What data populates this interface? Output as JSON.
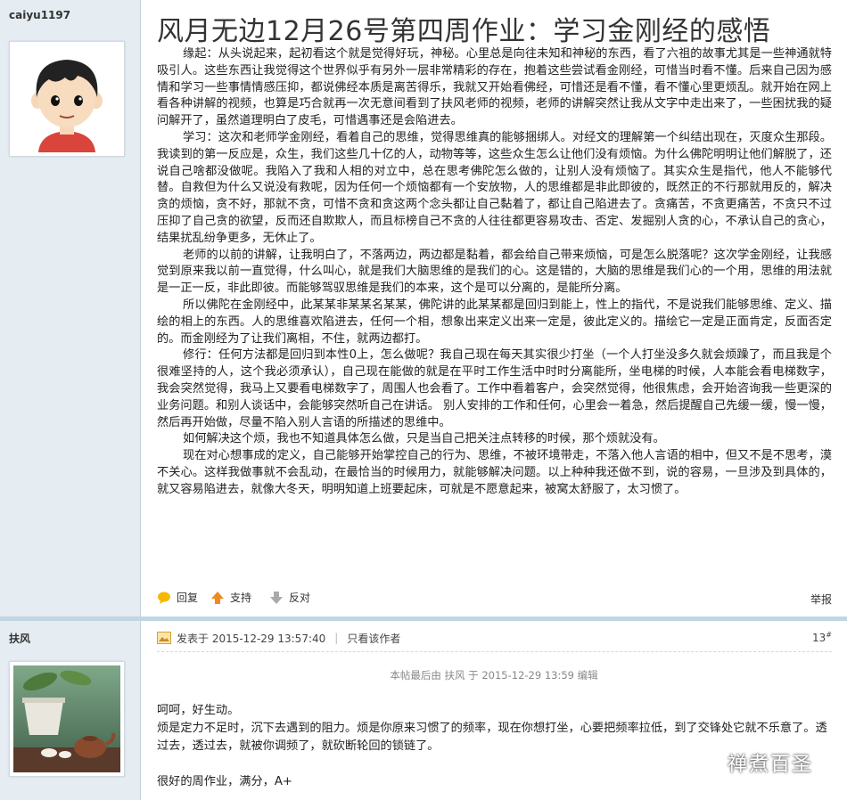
{
  "post1": {
    "username": "caiyu1197",
    "title": "风月无边12月26号第四周作业：学习金刚经的感悟",
    "paragraphs": [
      "缘起：从头说起来，起初看这个就是觉得好玩，神秘。心里总是向往未知和神秘的东西，看了六祖的故事尤其是一些神通就特吸引人。这些东西让我觉得这个世界似乎有另外一层非常精彩的存在，抱着这些尝试看金刚经，可惜当时看不懂。后来自己因为感情和学习一些事情情感压抑，都说佛经本质是离苦得乐，我就又开始看佛经，可惜还是看不懂，看不懂心里更烦乱。就开始在网上看各种讲解的视频，也算是巧合就再一次无意间看到了扶风老师的视频，老师的讲解突然让我从文字中走出来了，一些困扰我的疑问解开了，虽然道理明白了皮毛，可惜遇事还是会陷进去。",
      "学习：这次和老师学金刚经，看着自己的思维，觉得思维真的能够捆绑人。对经文的理解第一个纠结出现在，灭度众生那段。我读到的第一反应是，众生，我们这些几十亿的人，动物等等，这些众生怎么让他们没有烦恼。为什么佛陀明明让他们解脱了，还说自己啥都没做呢。我陷入了我和人相的对立中，总在思考佛陀怎么做的，让别人没有烦恼了。其实众生是指代，他人不能够代替。自救但为什么又说没有救呢，因为任何一个烦恼都有一个安放物，人的思维都是非此即彼的，既然正的不行那就用反的，解决贪的烦恼，贪不好，那就不贪，可惜不贪和贪这两个念头都让自己黏着了，都让自己陷进去了。贪痛苦，不贪更痛苦，不贪只不过压抑了自己贪的欲望，反而还自欺欺人，而且标榜自己不贪的人往往都更容易攻击、否定、发掘别人贪的心，不承认自己的贪心，结果扰乱纷争更多，无休止了。",
      "老师的以前的讲解，让我明白了，不落两边，两边都是黏着，都会给自己带来烦恼，可是怎么脱落呢？这次学金刚经，让我感觉到原来我以前一直觉得，什么叫心，就是我们大脑思维的是我们的心。这是错的，大脑的思维是我们心的一个用，思维的用法就是一正一反，非此即彼。而能够驾驭思维是我们的本来，这个是可以分离的，是能所分离。",
      "所以佛陀在金刚经中，此某某非某某名某某，佛陀讲的此某某都是回归到能上，性上的指代，不是说我们能够思维、定义、描绘的相上的东西。人的思维喜欢陷进去，任何一个相，想象出来定义出来一定是，彼此定义的。描绘它一定是正面肯定，反面否定的。而金刚经为了让我们离相，不住，就两边都打。",
      "修行：任何方法都是回归到本性0上，怎么做呢？我自己现在每天其实很少打坐（一个人打坐没多久就会烦躁了，而且我是个很难坚持的人，这个我必须承认），自己现在能做的就是在平时工作生活中时时分离能所，坐电梯的时候，人本能会看电梯数字，我会突然觉得，我马上又要看电梯数字了，周围人也会看了。工作中看着客户，会突然觉得，他很焦虑，会开始咨询我一些更深的业务问题。和别人谈话中，会能够突然听自己在讲话。 别人安排的工作和任何，心里会一着急，然后提醒自己先缓一缓，慢一慢，然后再开始做，尽量不陷入别人言语的所描述的思维中。",
      "如何解决这个烦，我也不知道具体怎么做，只是当自己把关注点转移的时候，那个烦就没有。",
      "现在对心想事成的定义，自己能够开始掌控自己的行为、思维，不被环境带走，不落入他人言语的相中，但又不是不思考，漠不关心。这样我做事就不会乱动，在最恰当的时候用力，就能够解决问题。以上种种我还做不到，说的容易，一旦涉及到具体的，就又容易陷进去，就像大冬天，明明知道上班要起床，可就是不愿意起来，被窝太舒服了，太习惯了。"
    ],
    "actions": {
      "reply": "回复",
      "support": "支持",
      "oppose": "反对",
      "report": "举报"
    }
  },
  "post2": {
    "username": "扶风",
    "posted_on": "发表于 2015-12-29 13:57:40",
    "only_author": "只看该作者",
    "floor": "13",
    "floor_sup": "#",
    "edit_note": "本帖最后由 扶风 于 2015-12-29 13:59 编辑",
    "lines": [
      "呵呵，好生动。",
      "烦是定力不足时，沉下去遇到的阻力。烦是你原来习惯了的频率，现在你想打坐，心要把频率拉低，到了交锋处它就不乐意了。透过去，透过去，就被你调频了，就砍断轮回的锁链了。",
      "",
      "很好的周作业，满分，A+"
    ]
  },
  "watermark": "禅煮百圣",
  "colors": {
    "sidebar_bg": "#e5edf2",
    "separator": "#c2d5e3",
    "support_arrow": "#f08a1c",
    "reply_icon": "#f5b800"
  }
}
